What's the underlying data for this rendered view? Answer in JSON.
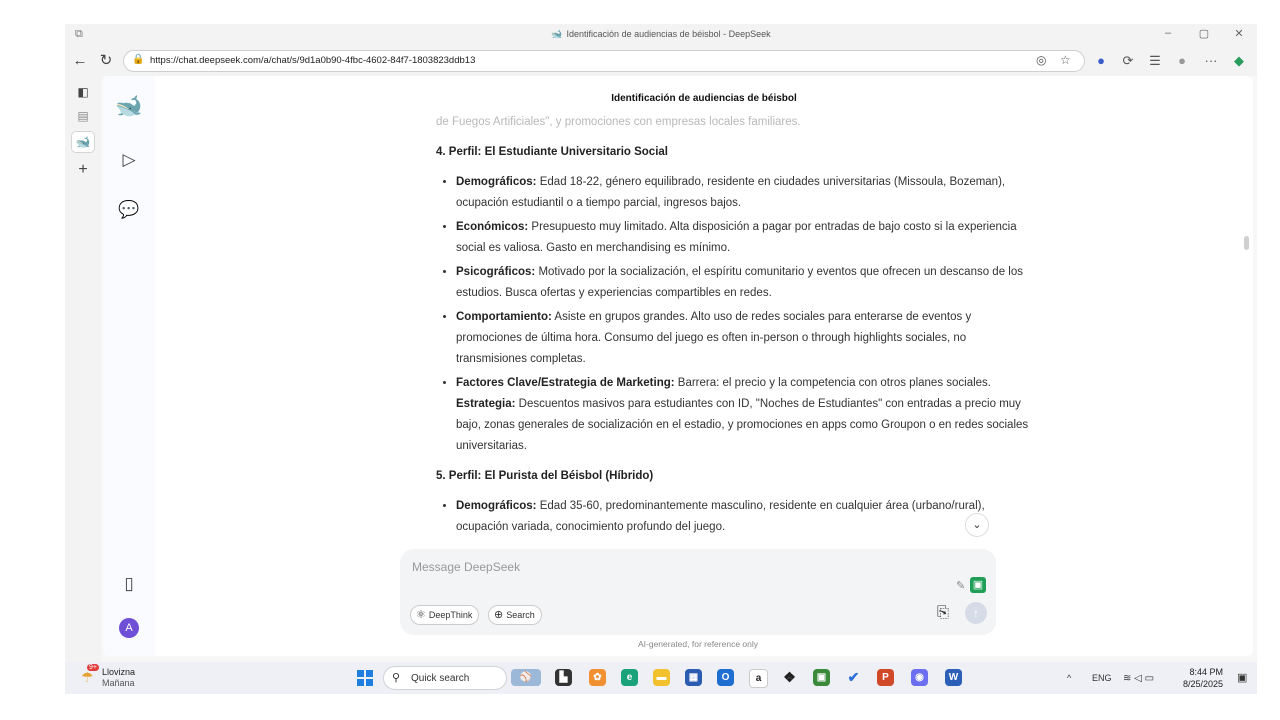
{
  "window": {
    "title": "Identificación de audiencias de béisbol - DeepSeek",
    "minimize": "–",
    "restore": "▢",
    "close": "✕"
  },
  "browser": {
    "url": "https://chat.deepseek.com/a/chat/s/9d1a0b90-4fbc-4602-84f7-1803823ddb13",
    "back": "←",
    "reload": "↻",
    "more": "···"
  },
  "chat": {
    "title": "Identificación de audiencias de béisbol",
    "faded_top": "de Fuegos Artificiales\", y promociones con empresas locales familiares.",
    "sections": [
      {
        "heading": "4. Perfil: El Estudiante Universitario Social",
        "items": [
          {
            "label": "Demográficos:",
            "text": " Edad 18-22, género equilibrado, residente en ciudades universitarias (Missoula, Bozeman), ocupación estudiantil o a tiempo parcial, ingresos bajos."
          },
          {
            "label": "Económicos:",
            "text": " Presupuesto muy limitado. Alta disposición a pagar por entradas de bajo costo si la experiencia social es valiosa. Gasto en merchandising es mínimo."
          },
          {
            "label": "Psicográficos:",
            "text": " Motivado por la socialización, el espíritu comunitario y eventos que ofrecen un descanso de los estudios. Busca ofertas y experiencias compartibles en redes."
          },
          {
            "label": "Comportamiento:",
            "text": " Asiste en grupos grandes. Alto uso de redes sociales para enterarse de eventos y promociones de última hora. Consumo del juego es often in-person o through highlights sociales, no transmisiones completas."
          },
          {
            "label": "Factores Clave/Estrategia de Marketing:",
            "text": " Barrera: el precio y la competencia con otros planes sociales.",
            "label2": "Estrategia:",
            "text2": " Descuentos masivos para estudiantes con ID, \"Noches de Estudiantes\" con entradas a precio muy bajo, zonas generales de socialización en el estadio, y promociones en apps como Groupon o en redes sociales universitarias."
          }
        ]
      },
      {
        "heading": "5. Perfil: El Purista del Béisbol (Híbrido)",
        "items": [
          {
            "label": "Demográficos:",
            "text": " Edad 35-60, predominantemente masculino, residente en cualquier área (urbano/rural), ocupación variada, conocimiento profundo del juego."
          }
        ]
      }
    ],
    "composer": {
      "placeholder": "Message DeepSeek",
      "deepthink": "DeepThink",
      "search": "Search"
    },
    "disclaimer": "AI-generated, for reference only",
    "avatar_letter": "A"
  },
  "taskbar": {
    "weather_badge": "9+",
    "weather_line1": "Llovizna",
    "weather_line2": "Mañana",
    "search": "Quick search",
    "lang": "ENG",
    "time": "8:44 PM",
    "date": "8/25/2025"
  },
  "colors": {
    "accent": "#4d6bfe",
    "avatar": "#6e4fd6"
  },
  "icons": [
    "deepseek-logo-icon",
    "new-chat-icon",
    "sidebar-toggle-icon",
    "phone-icon",
    "attach-icon",
    "send-icon",
    "scroll-down-icon",
    "windows-start-icon"
  ]
}
